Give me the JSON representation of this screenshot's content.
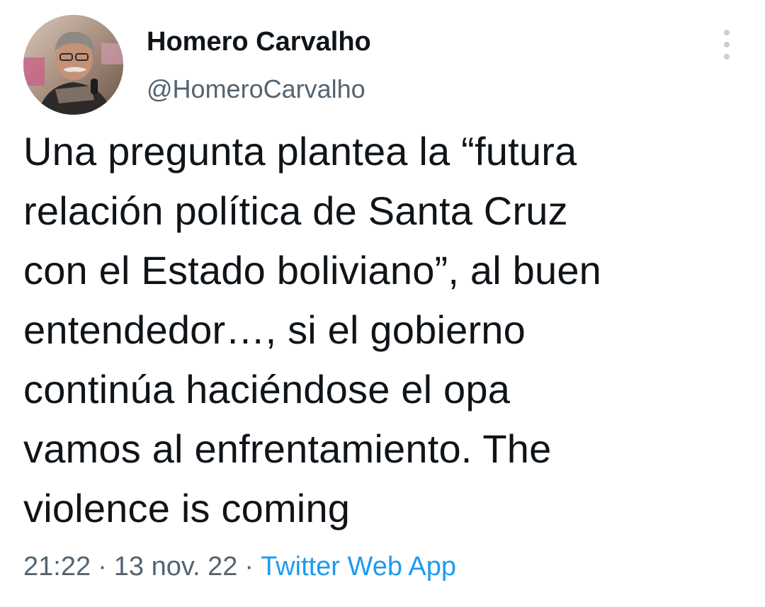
{
  "author": {
    "display_name": "Homero Carvalho",
    "handle": "@HomeroCarvalho",
    "avatar_icon": "profile-photo"
  },
  "more_icon": "more-vertical-icon",
  "tweet": {
    "text": "Una pregunta plantea la “futura\nrelación política de Santa Cruz\ncon el Estado boliviano”, al buen\nentendedor…, si el gobierno\ncontinúa haciéndose el opa\nvamos al enfrentamiento. The\nviolence is coming"
  },
  "meta": {
    "time": "21:22",
    "separator": "·",
    "date": "13 nov. 22",
    "source": "Twitter Web App"
  },
  "colors": {
    "text": "#0f1419",
    "secondary": "#536471",
    "link": "#1d9bf0"
  }
}
